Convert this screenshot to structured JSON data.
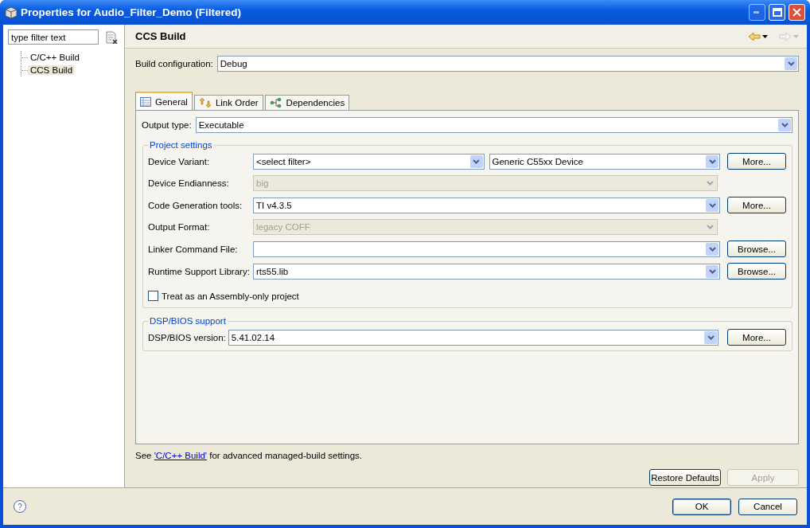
{
  "window": {
    "title": "Properties for Audio_Filter_Demo (Filtered)"
  },
  "sidebar": {
    "filter": {
      "placeholder": "type filter text"
    },
    "items": [
      {
        "label": "C/C++ Build",
        "selected": false
      },
      {
        "label": "CCS Build",
        "selected": true
      }
    ]
  },
  "page": {
    "title": "CCS Build",
    "build_configuration": {
      "label": "Build configuration:",
      "value": "Debug"
    },
    "tabs": [
      {
        "label": "General",
        "selected": true,
        "kind": "table"
      },
      {
        "label": "Link Order",
        "selected": false,
        "kind": "arrows"
      },
      {
        "label": "Dependencies",
        "selected": false,
        "kind": "tree"
      }
    ],
    "output_type": {
      "label": "Output type:",
      "value": "Executable"
    },
    "project_settings": {
      "title": "Project settings",
      "rows": [
        {
          "label": "Device Variant:",
          "fields": [
            {
              "value": "<select filter>",
              "disabled": false
            },
            {
              "value": "Generic C55xx Device",
              "disabled": false
            }
          ],
          "button": "More..."
        },
        {
          "label": "Device Endianness:",
          "fields": [
            {
              "value": "big",
              "disabled": true
            }
          ]
        },
        {
          "label": "Code Generation tools:",
          "fields": [
            {
              "value": "TI v4.3.5",
              "disabled": false
            }
          ],
          "button": "More..."
        },
        {
          "label": "Output Format:",
          "fields": [
            {
              "value": "legacy COFF",
              "disabled": true
            }
          ]
        },
        {
          "label": "Linker Command File:",
          "fields": [
            {
              "disabled": false
            }
          ],
          "button": "Browse..."
        },
        {
          "label": "Runtime Support Library:",
          "fields": [
            {
              "value": "rts55.lib",
              "disabled": false
            }
          ],
          "button": "Browse..."
        }
      ],
      "checkbox": {
        "label": "Treat as an Assembly-only project",
        "checked": false
      }
    },
    "dsp_bios": {
      "title": "DSP/BIOS support",
      "label": "DSP/BIOS version:",
      "value": "5.41.02.14",
      "button": "More..."
    },
    "note": {
      "before": "See ",
      "link": "'C/C++ Build'",
      "after": " for advanced managed-build settings."
    },
    "buttons": [
      {
        "label": "Restore Defaults",
        "disabled": false
      },
      {
        "label": "Apply",
        "disabled": true
      }
    ]
  },
  "footer": {
    "help": "?",
    "buttons": [
      {
        "label": "OK",
        "default": true
      },
      {
        "label": "Cancel",
        "default": false
      }
    ]
  }
}
